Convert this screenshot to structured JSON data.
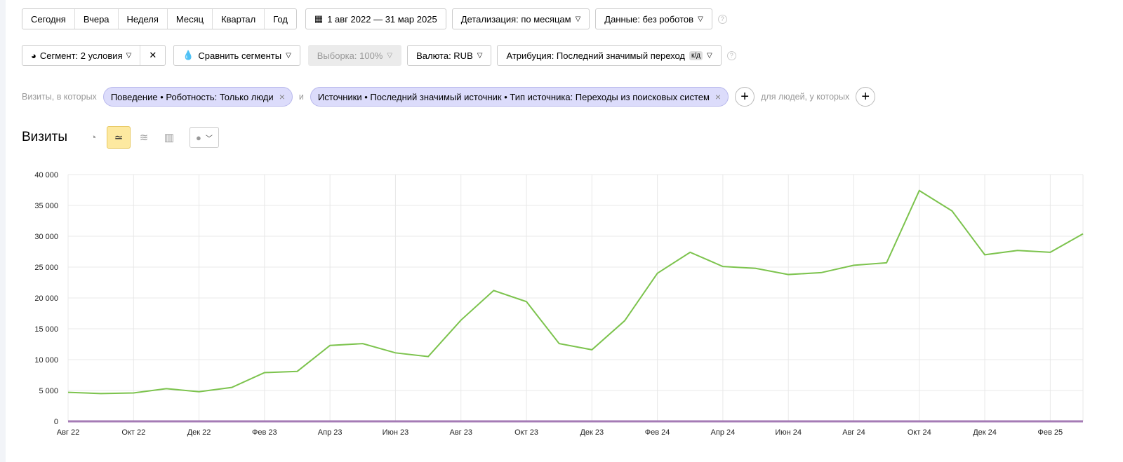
{
  "periods": [
    "Сегодня",
    "Вчера",
    "Неделя",
    "Месяц",
    "Квартал",
    "Год"
  ],
  "date_range": "1 авг 2022 — 31 мар 2025",
  "detail": "Детализация: по месяцам",
  "data_filter": "Данные: без роботов",
  "segment": "Сегмент: 2 условия",
  "compare": "Сравнить сегменты",
  "sample": "Выборка: 100%",
  "currency": "Валюта: RUB",
  "attribution": "Атрибуция: Последний значимый переход",
  "attribution_badge": "к/д",
  "filters": {
    "prefix": "Визиты, в которых",
    "chips": [
      "Поведение • Роботность: Только люди",
      "Источники • Последний значимый источник • Тип источника: Переходы из поисковых систем"
    ],
    "joiner": "и",
    "people": "для людей, у которых"
  },
  "chart_title": "Визиты",
  "colors": {
    "line": "#7cc34d",
    "baseline": "#a57bb5"
  },
  "chart_data": {
    "type": "line",
    "title": "Визиты",
    "ylim": [
      0,
      40000
    ],
    "yticks": [
      "0",
      "5 000",
      "10 000",
      "15 000",
      "20 000",
      "25 000",
      "30 000",
      "35 000",
      "40 000"
    ],
    "xtick_labels": [
      "Авг 22",
      "Окт 22",
      "Дек 22",
      "Фев 23",
      "Апр 23",
      "Июн 23",
      "Авг 23",
      "Окт 23",
      "Дек 23",
      "Фев 24",
      "Апр 24",
      "Июн 24",
      "Авг 24",
      "Окт 24",
      "Дек 24",
      "Фев 25"
    ],
    "x": [
      "2022-08",
      "2022-09",
      "2022-10",
      "2022-11",
      "2022-12",
      "2023-01",
      "2023-02",
      "2023-03",
      "2023-04",
      "2023-05",
      "2023-06",
      "2023-07",
      "2023-08",
      "2023-09",
      "2023-10",
      "2023-11",
      "2023-12",
      "2024-01",
      "2024-02",
      "2024-03",
      "2024-04",
      "2024-05",
      "2024-06",
      "2024-07",
      "2024-08",
      "2024-09",
      "2024-10",
      "2024-11",
      "2024-12",
      "2025-01",
      "2025-02",
      "2025-03"
    ],
    "grid": true,
    "series": [
      {
        "values": [
          4700,
          4500,
          4600,
          5300,
          4800,
          5500,
          7900,
          8100,
          12300,
          12600,
          11100,
          10500,
          16400,
          21200,
          19400,
          12600,
          11600,
          16300,
          24000,
          27400,
          25100,
          24800,
          23800,
          24100,
          25300,
          25700,
          37400,
          34100,
          27000,
          27700,
          27400,
          30400
        ]
      },
      {
        "values": [
          0,
          0,
          0,
          0,
          0,
          0,
          0,
          0,
          0,
          0,
          0,
          0,
          0,
          0,
          0,
          0,
          0,
          0,
          0,
          0,
          0,
          0,
          0,
          0,
          0,
          0,
          0,
          0,
          0,
          0,
          0,
          0
        ]
      }
    ]
  }
}
